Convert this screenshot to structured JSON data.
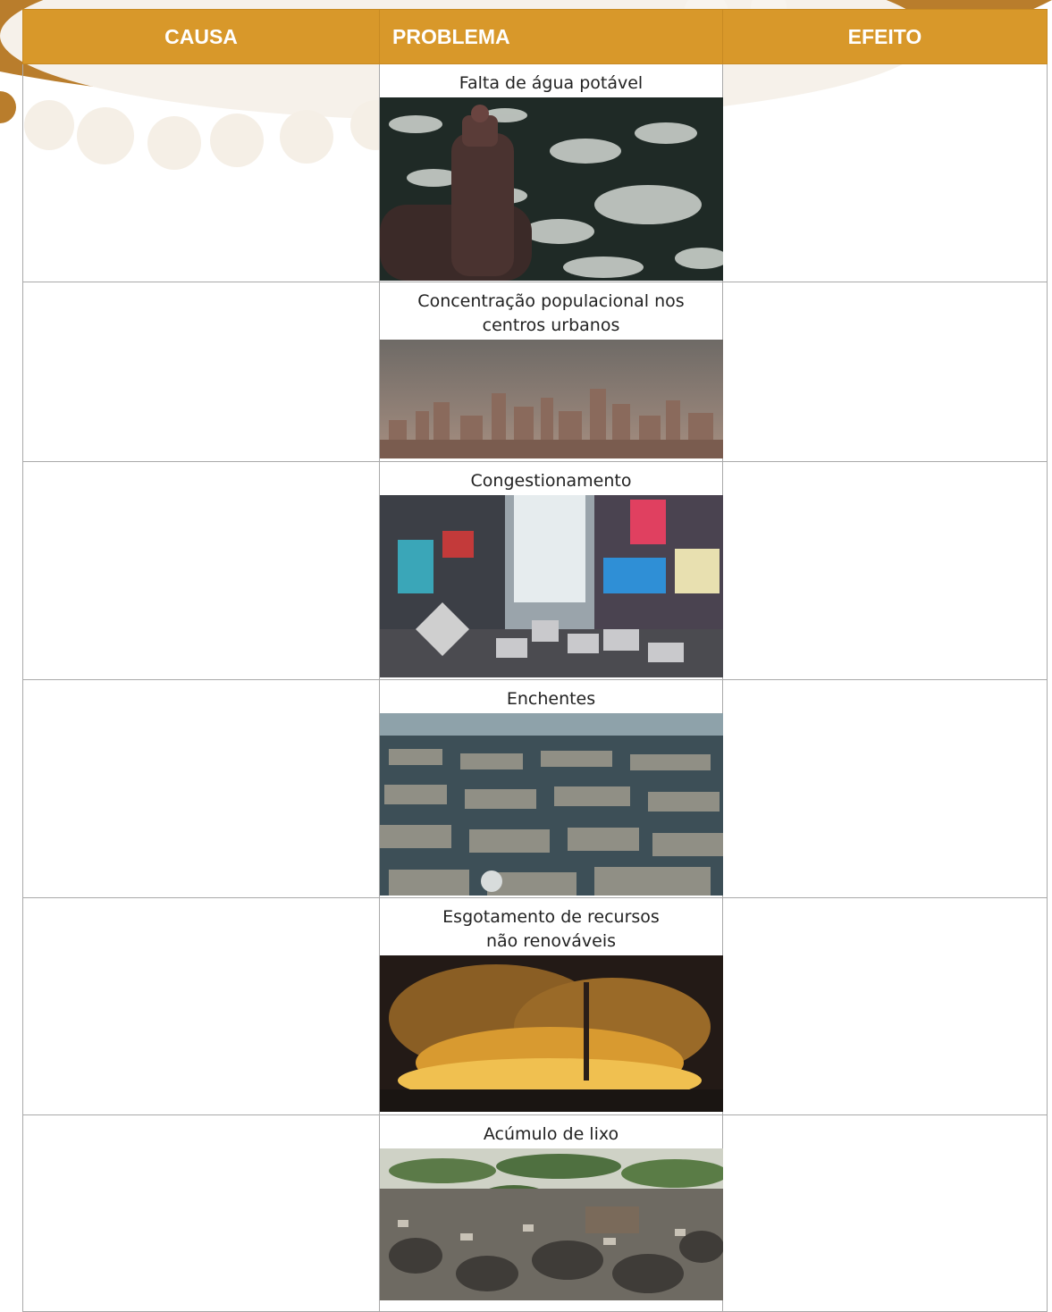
{
  "table": {
    "headers": {
      "cause": "CAUSA",
      "problem": "PROBLEMA",
      "effect": "EFEITO"
    },
    "rows": [
      {
        "problem": "Falta de água potável",
        "effect": "",
        "cause": ""
      },
      {
        "problem": "Concentração populacional nos centros urbanos",
        "effect": "",
        "cause": ""
      },
      {
        "problem": "Congestionamento",
        "effect": "",
        "cause": ""
      },
      {
        "problem": "Enchentes",
        "effect": "",
        "cause": ""
      },
      {
        "problem": "Esgotamento de recursos não renováveis",
        "effect": "",
        "cause": ""
      },
      {
        "problem": "Acúmulo de lixo",
        "effect": "",
        "cause": ""
      }
    ]
  },
  "colors": {
    "header_bg": "#d8982a",
    "header_text": "#ffffff",
    "border": "#a9a9a9",
    "decor": "#f4efe6"
  }
}
